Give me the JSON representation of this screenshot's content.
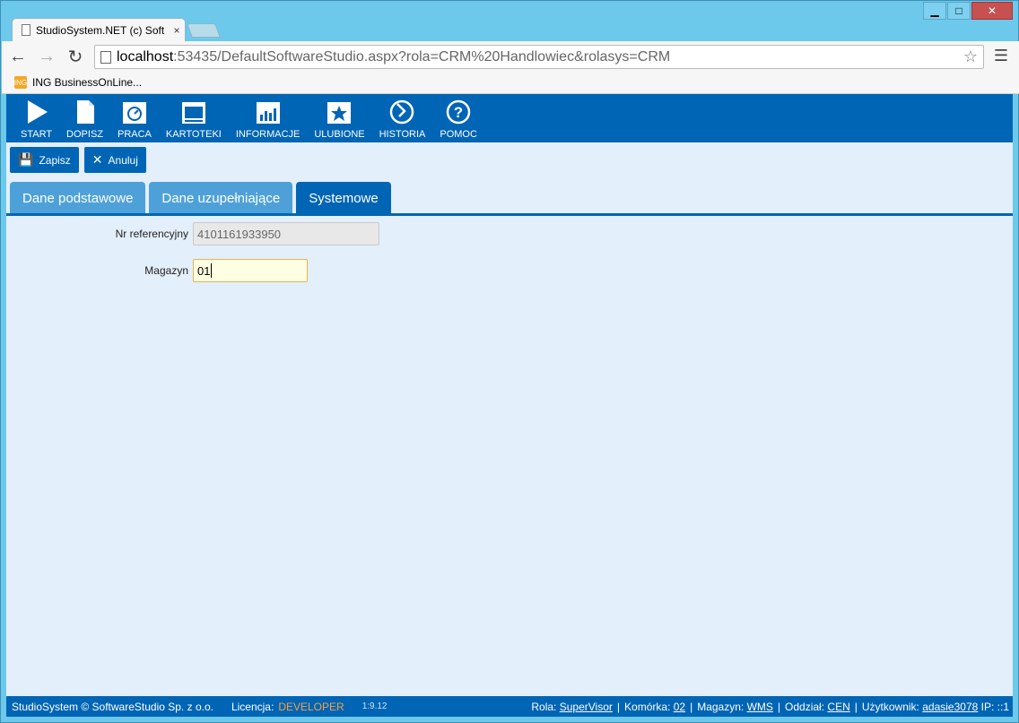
{
  "window": {
    "minimize": "▁",
    "maximize": "□",
    "close": "✕"
  },
  "browser": {
    "tab_title": "StudioSystem.NET (c) Soft",
    "tab_close": "×",
    "url_host": "localhost",
    "url_rest": ":53435/DefaultSoftwareStudio.aspx?rola=CRM%20Handlowiec&rolasys=CRM",
    "bookmark": "ING BusinessOnLine...",
    "bookmark_icon_text": "ING"
  },
  "ribbon": {
    "items": [
      {
        "label": "START",
        "icon": "play-icon"
      },
      {
        "label": "DOPISZ",
        "icon": "document-icon"
      },
      {
        "label": "PRACA",
        "icon": "gauge-icon"
      },
      {
        "label": "KARTOTEKI",
        "icon": "window-icon"
      },
      {
        "label": "INFORMACJE",
        "icon": "chart-icon"
      },
      {
        "label": "ULUBIONE",
        "icon": "star-icon"
      },
      {
        "label": "HISTORIA",
        "icon": "history-icon"
      },
      {
        "label": "POMOC",
        "icon": "help-icon"
      }
    ]
  },
  "actions": {
    "save": "Zapisz",
    "cancel": "Anuluj"
  },
  "tabs": [
    "Dane podstawowe",
    "Dane uzupełniające",
    "Systemowe"
  ],
  "form": {
    "ref_label": "Nr referencyjny",
    "ref_value": "4101161933950",
    "mag_label": "Magazyn",
    "mag_value": "01"
  },
  "footer": {
    "copyright": "StudioSystem © SoftwareStudio Sp. z o.o.",
    "licence_label": "Licencja:",
    "licence_value": "DEVELOPER",
    "version": "1:9.12",
    "role_label": "Rola:",
    "role_value": "SuperVisor",
    "cell_label": "Komórka:",
    "cell_value": "02",
    "wh_label": "Magazyn:",
    "wh_value": "WMS",
    "branch_label": "Oddział:",
    "branch_value": "CEN",
    "user_label": "Użytkownik:",
    "user_value": "adasie3078",
    "ip_label": "IP:",
    "ip_value": "::1"
  }
}
